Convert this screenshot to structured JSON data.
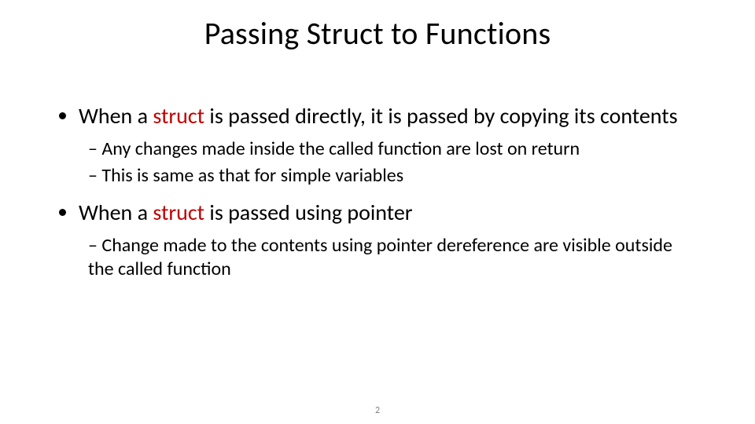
{
  "slide": {
    "title": "Passing Struct to Functions",
    "page_number": "2",
    "bullets": [
      {
        "pre": "When a ",
        "kw": "struct",
        "post": " is passed directly, it is passed by copying its contents",
        "sub": [
          "Any changes made inside the called function are lost on return",
          "This is same as that for simple variables"
        ]
      },
      {
        "pre": "When a ",
        "kw": "struct",
        "post": " is passed using pointer",
        "sub": [
          "Change made to the contents using pointer dereference are visible outside the called function"
        ]
      }
    ]
  }
}
